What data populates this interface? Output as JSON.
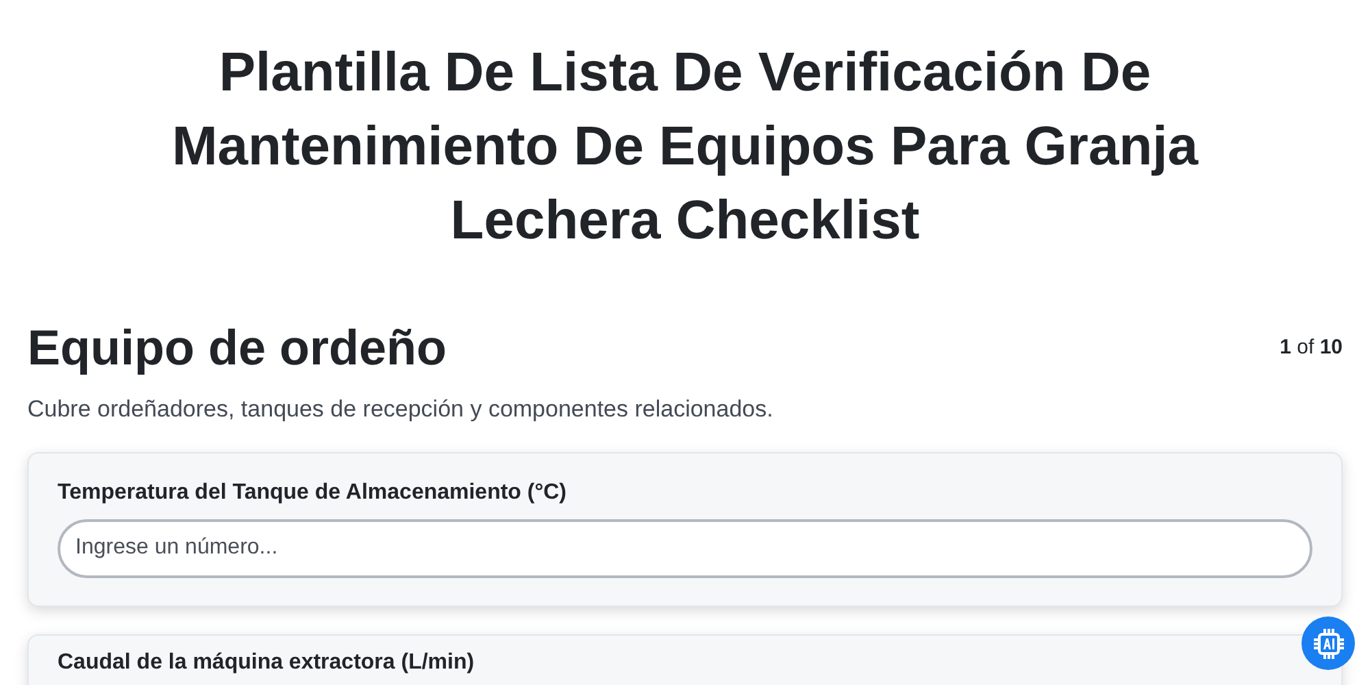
{
  "title": "Plantilla De Lista De Verificación De Mantenimiento De Equipos Para Granja Lechera Checklist",
  "section": {
    "heading": "Equipo de ordeño",
    "counter": "**1** of **10**",
    "description": "Cubre ordeñadores, tanques de recepción y componentes relacionados."
  },
  "fields": [
    {
      "label": "Temperatura del Tanque de Almacenamiento (°C)",
      "placeholder": "Ingrese un número..."
    },
    {
      "label": "Caudal de la máquina extractora (L/min)"
    }
  ]
}
